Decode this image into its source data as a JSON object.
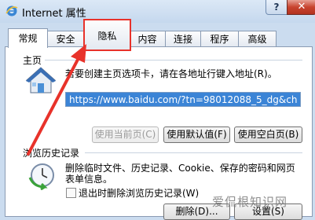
{
  "window": {
    "title": "Internet 属性",
    "help_label": "?",
    "close_label": "✕"
  },
  "tabs": [
    {
      "label": "常规",
      "active": true
    },
    {
      "label": "安全",
      "active": false
    },
    {
      "label": "隐私",
      "active": false,
      "highlighted": true
    },
    {
      "label": "内容",
      "active": false
    },
    {
      "label": "连接",
      "active": false
    },
    {
      "label": "程序",
      "active": false
    },
    {
      "label": "高级",
      "active": false
    }
  ],
  "home": {
    "group_label": "主页",
    "description": "若要创建主页选项卡，请在各地址行键入地址(R)。",
    "url_value": "https://www.baidu.com/?tn=98012088_5_dg&ch",
    "buttons": {
      "use_current": "使用当前页(C)",
      "use_default": "使用默认值(F)",
      "use_blank": "使用空白页(B)"
    }
  },
  "history": {
    "group_label": "浏览历史记录",
    "description_line1": "删除临时文件、历史记录、Cookie、保存的密码和网页",
    "description_line2": "表单信息。",
    "checkbox_label": "退出时删除浏览历史记录(W)",
    "checkbox_checked": false,
    "buttons": {
      "delete": "删除(D)...",
      "settings": "设置(S)"
    }
  },
  "annotation": {
    "color": "#e8322a"
  },
  "watermark": {
    "text": "爱侃根知识网"
  }
}
